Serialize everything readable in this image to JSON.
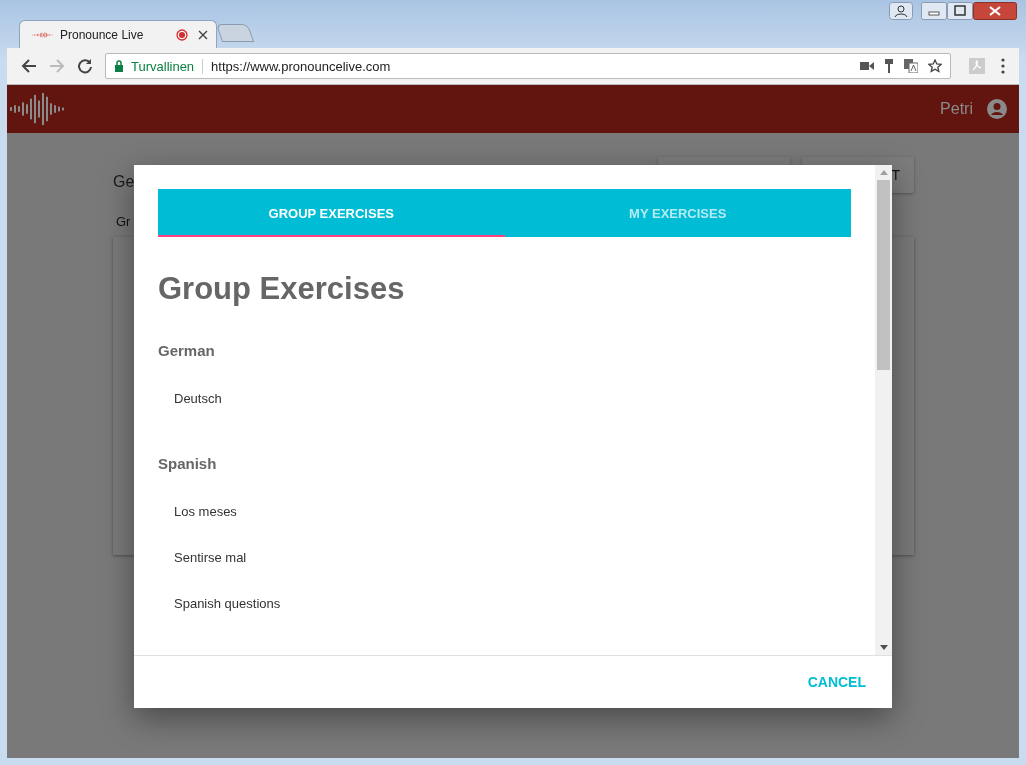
{
  "browser": {
    "tabs": [
      {
        "title": "Pronounce Live",
        "selected": true,
        "recording": true
      },
      {
        "selected": false
      }
    ],
    "address": {
      "secure_label": "Turvallinen",
      "url": "https://www.pronouncelive.com"
    }
  },
  "app_header": {
    "user": "Petri"
  },
  "background_page": {
    "heading": "Ge",
    "label": "Gr",
    "button_2": "T"
  },
  "dialog": {
    "tabs": [
      {
        "label": "GROUP EXERCISES",
        "selected": true
      },
      {
        "label": "MY EXERCISES",
        "selected": false
      }
    ],
    "title": "Group Exercises",
    "groups": [
      {
        "name": "German",
        "items": [
          "Deutsch"
        ]
      },
      {
        "name": "Spanish",
        "items": [
          "Los meses",
          "Sentirse mal",
          "Spanish questions"
        ]
      }
    ],
    "actions": [
      "CANCEL"
    ]
  }
}
